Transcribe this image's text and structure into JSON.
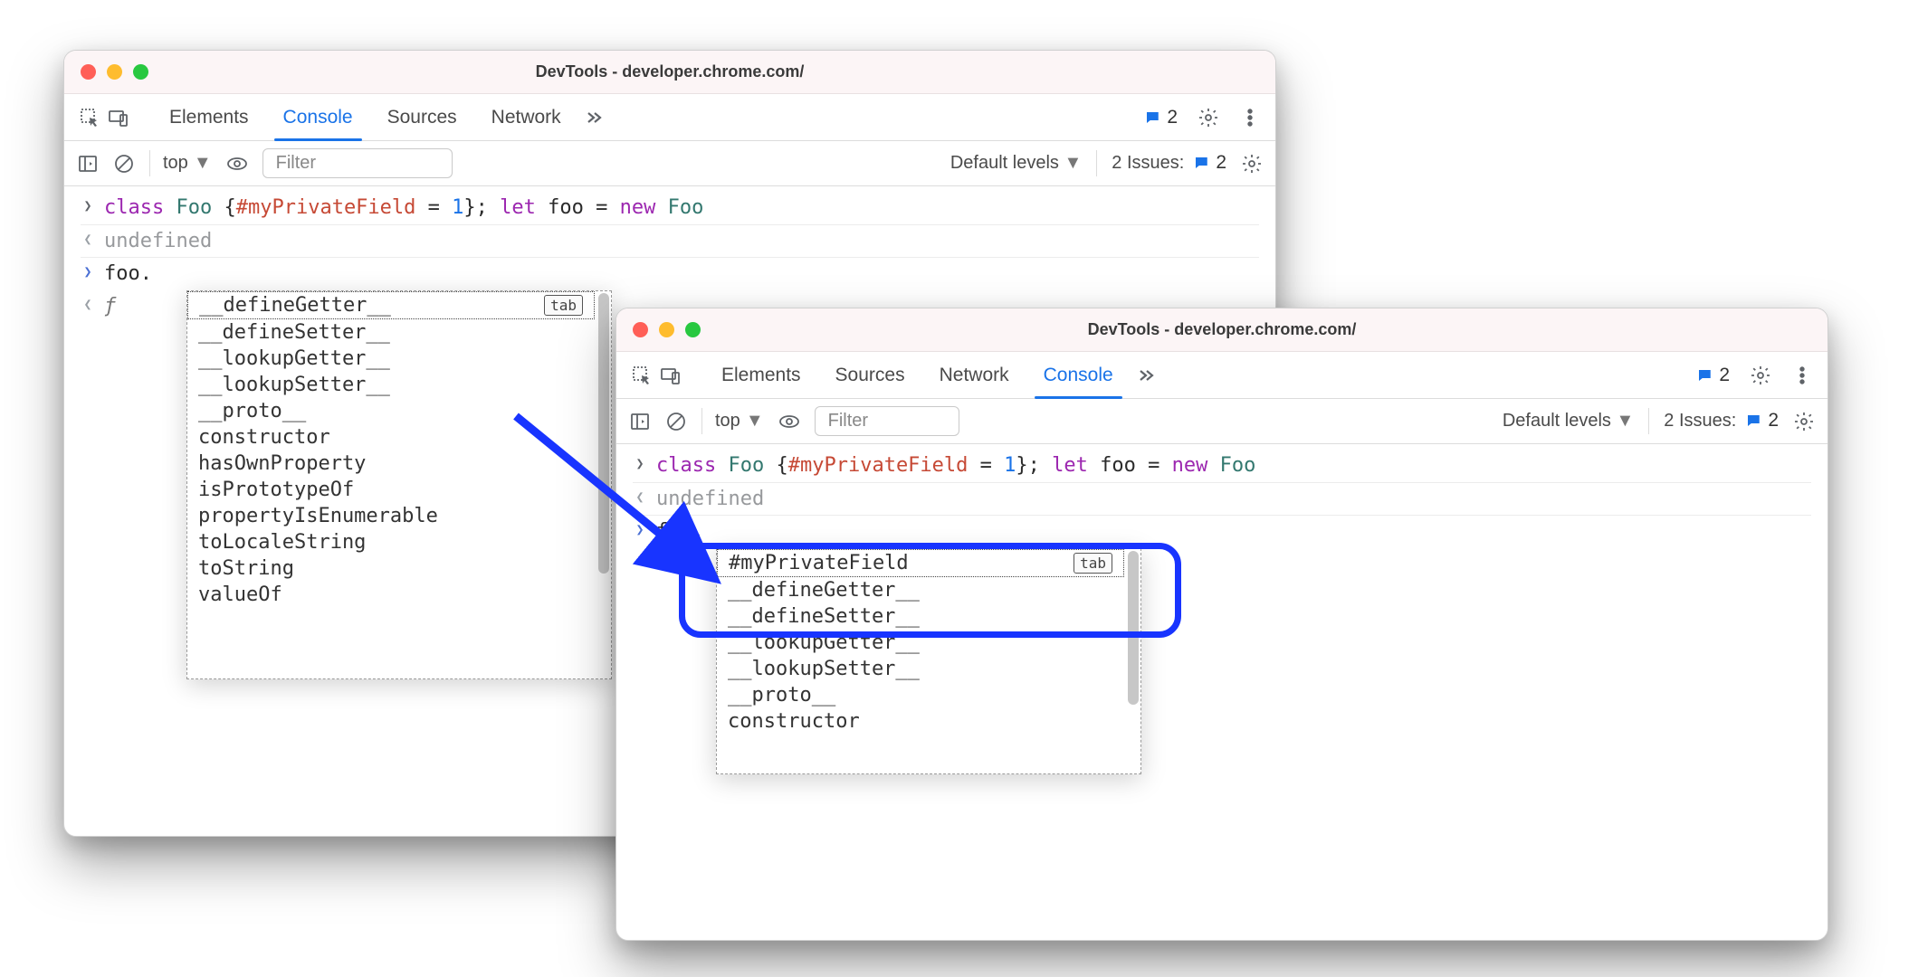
{
  "windows": [
    {
      "title": "DevTools - developer.chrome.com/",
      "tabs": [
        "Elements",
        "Console",
        "Sources",
        "Network"
      ],
      "active_tab": "Console",
      "issues_count": "2",
      "toolbar": {
        "context": "top",
        "filter_placeholder": "Filter",
        "levels": "Default levels",
        "issues_label": "2 Issues:",
        "issues_badge": "2"
      },
      "console": {
        "input_line": {
          "tokens": [
            {
              "t": "class",
              "c": "kw-purple"
            },
            {
              "t": " ",
              "c": ""
            },
            {
              "t": "Foo",
              "c": "kw-teal"
            },
            {
              "t": " {",
              "c": ""
            },
            {
              "t": "#myPrivateField",
              "c": "kw-red"
            },
            {
              "t": " = ",
              "c": ""
            },
            {
              "t": "1",
              "c": "num-blue"
            },
            {
              "t": "}; ",
              "c": ""
            },
            {
              "t": "let",
              "c": "kw-purple"
            },
            {
              "t": " foo = ",
              "c": ""
            },
            {
              "t": "new",
              "c": "kw-purple"
            },
            {
              "t": " ",
              "c": ""
            },
            {
              "t": "Foo",
              "c": "kw-teal"
            }
          ]
        },
        "result": "undefined",
        "prompt": "foo.",
        "eager_eval": "ƒ",
        "autocomplete": [
          "__defineGetter__",
          "__defineSetter__",
          "__lookupGetter__",
          "__lookupSetter__",
          "__proto__",
          "constructor",
          "hasOwnProperty",
          "isPrototypeOf",
          "propertyIsEnumerable",
          "toLocaleString",
          "toString",
          "valueOf"
        ],
        "tab_hint": "tab"
      }
    },
    {
      "title": "DevTools - developer.chrome.com/",
      "tabs": [
        "Elements",
        "Sources",
        "Network",
        "Console"
      ],
      "active_tab": "Console",
      "issues_count": "2",
      "toolbar": {
        "context": "top",
        "filter_placeholder": "Filter",
        "levels": "Default levels",
        "issues_label": "2 Issues:",
        "issues_badge": "2"
      },
      "console": {
        "input_line": {
          "tokens": [
            {
              "t": "class",
              "c": "kw-purple"
            },
            {
              "t": " ",
              "c": ""
            },
            {
              "t": "Foo",
              "c": "kw-teal"
            },
            {
              "t": " {",
              "c": ""
            },
            {
              "t": "#myPrivateField",
              "c": "kw-red"
            },
            {
              "t": " = ",
              "c": ""
            },
            {
              "t": "1",
              "c": "num-blue"
            },
            {
              "t": "}; ",
              "c": ""
            },
            {
              "t": "let",
              "c": "kw-purple"
            },
            {
              "t": " foo = ",
              "c": ""
            },
            {
              "t": "new",
              "c": "kw-purple"
            },
            {
              "t": " ",
              "c": ""
            },
            {
              "t": "Foo",
              "c": "kw-teal"
            }
          ]
        },
        "result": "undefined",
        "prompt": "foo.",
        "autocomplete": [
          "#myPrivateField",
          "__defineGetter__",
          "__defineSetter__",
          "__lookupGetter__",
          "__lookupSetter__",
          "__proto__",
          "constructor"
        ],
        "tab_hint": "tab"
      }
    }
  ]
}
